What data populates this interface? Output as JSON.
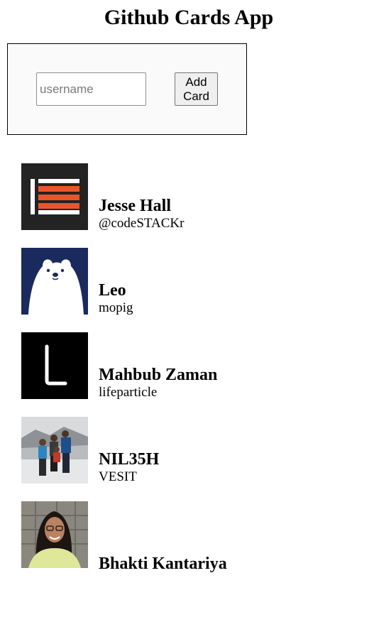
{
  "app": {
    "title": "Github Cards App"
  },
  "form": {
    "username_placeholder": "username",
    "username_value": "",
    "add_button_label": "Add\nCard"
  },
  "cards": [
    {
      "name": "Jesse Hall",
      "company": "@codeSTACKr",
      "avatar_icon": "stacked-bars-logo-icon"
    },
    {
      "name": "Leo",
      "company": "mopig",
      "avatar_icon": "polar-bear-icon"
    },
    {
      "name": "Mahbub Zaman",
      "company": "lifeparticle",
      "avatar_icon": "letter-l-icon"
    },
    {
      "name": "NIL35H",
      "company": "VESIT",
      "avatar_icon": "group-photo-icon"
    },
    {
      "name": "Bhakti Kantariya",
      "company": "",
      "avatar_icon": "portrait-photo-icon"
    }
  ],
  "colors": {
    "form_background": "#fafafa",
    "stack_orange": "#e8562a",
    "bear_navy": "#1b2a5c"
  }
}
